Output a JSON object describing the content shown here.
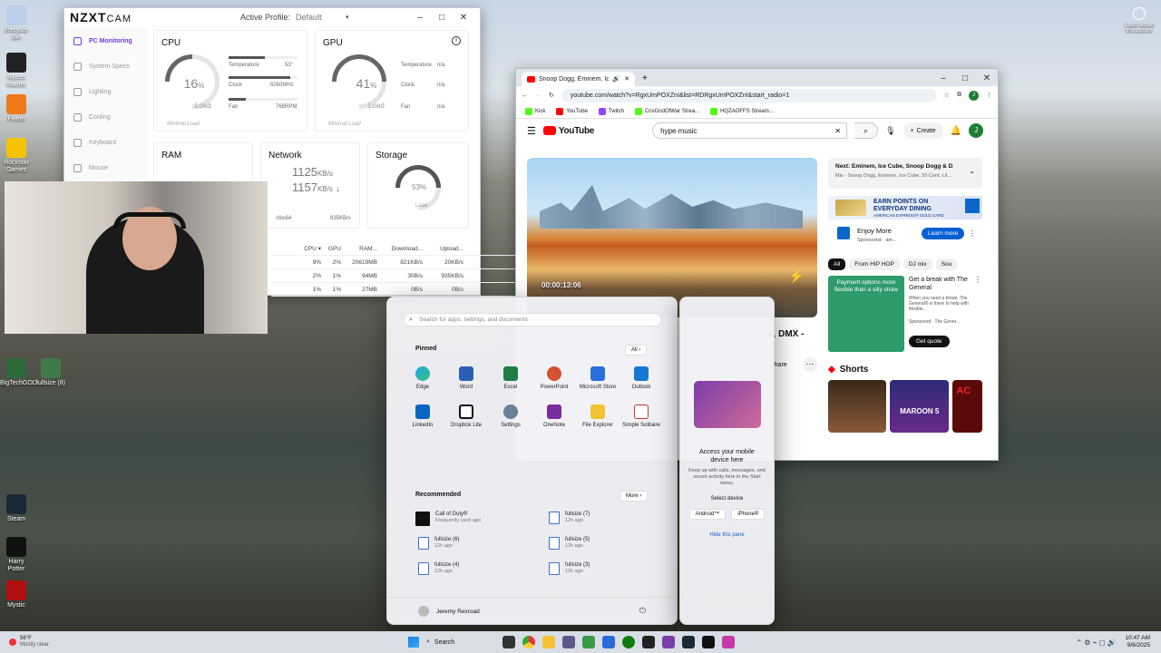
{
  "desktop": {
    "learn_about": "Learn about this picture",
    "icons": [
      "Recycle Bin",
      "Ryzen Master",
      "Fivem",
      "Rockstar Games",
      "BigTechGOD...",
      "fullsize (8)",
      "Steam",
      "Harry Potter",
      "Mystic"
    ]
  },
  "nzxt": {
    "logo": "NZXT",
    "logo_sub": "CAM",
    "profile_label": "Active Profile:",
    "profile_value": "Default",
    "nav": [
      "PC Monitoring",
      "System Specs",
      "Lighting",
      "Cooling",
      "Keyboard",
      "Mouse"
    ],
    "cpu": {
      "title": "CPU",
      "load": "16",
      "load_unit": "%",
      "load_label": "Load",
      "temp_label": "Temperature",
      "temp_value": "53°",
      "clock_label": "Clock",
      "clock_value": "5050MHz",
      "fan_label": "Fan",
      "fan_value": "768RPM",
      "footer": "Minimal Load"
    },
    "gpu": {
      "title": "GPU",
      "load": "41",
      "load_unit": "%",
      "load_label": "Load",
      "temp_label": "Temperature",
      "temp_value": "n/a",
      "clock_label": "Clock",
      "clock_value": "n/a",
      "fan_label": "Fan",
      "fan_value": "n/a",
      "footer": "Minimal Load"
    },
    "ram": {
      "title": "RAM"
    },
    "network": {
      "title": "Network",
      "down": "1125",
      "up": "1157",
      "unit": "KB/s",
      "adapter": "clbs64",
      "adapter_val": "935KB/s"
    },
    "storage": {
      "title": "Storage",
      "load": "53%",
      "load_label": "Load"
    },
    "table": {
      "headers": [
        "CPU ▾",
        "GPU",
        "RAM...",
        "Download...",
        "Upload..."
      ],
      "rows": [
        [
          "9%",
          "2%",
          "20619MB",
          "821KB/s",
          "20KB/s"
        ],
        [
          "2%",
          "1%",
          "94MB",
          "30B/s",
          "935KB/s"
        ],
        [
          "1%",
          "1%",
          "27MB",
          "0B/s",
          "0B/s"
        ]
      ]
    }
  },
  "chrome": {
    "tab_title": "Snoop Dogg, Eminem, Ice C",
    "url": "youtube.com/watch?v=RgxUmPOXZnI&list=RDRgxUmPOXZnI&start_radio=1",
    "bookmarks": [
      "Kick",
      "YouTube",
      "Twitch",
      "CrisGodOfWar Strea...",
      "HQZAOFFS Stream..."
    ],
    "yt": {
      "logo": "YouTube",
      "search": "hype music",
      "create": "Create",
      "avatar": "J",
      "time": "00:00:13:06",
      "title_frag": "e, DMX -",
      "share": "Share",
      "next_title": "Next: Eminem, Ice Cube, Snoop Dogg & D...",
      "next_sub": "Mix - Snoop Dogg, Eminem, Ice Cube, 50 Cent, Lil...",
      "ad1_title": "EARN POINTS ON EVERYDAY DINING",
      "ad1_sub": "AMERICAN EXPRESS® GOLD CARD",
      "ad1_cta": "Enjoy More",
      "ad1_spon": "Sponsored · am...",
      "ad1_btn": "Learn more",
      "chips": [
        "All",
        "From HIP HOP",
        "DJ mix",
        "Sou"
      ],
      "ad2_img": "Payment options more flexible than a silly straw",
      "ad2_title": "Get a break with The General",
      "ad2_desc": "When you need a break, The General® is there to help with flexible...",
      "ad2_spon": "Sponsored · The Gener...",
      "ad2_btn": "Get quote",
      "shorts": "Shorts",
      "short2": "MAROON 5",
      "short3": "AC"
    }
  },
  "start": {
    "search_placeholder": "Search for apps, settings, and documents",
    "pinned": "Pinned",
    "all": "All",
    "apps": [
      "Edge",
      "Word",
      "Excel",
      "PowerPoint",
      "Microsoft Store",
      "Outlook",
      "LinkedIn",
      "Dropbox Lite",
      "Settings",
      "OneNote",
      "File Explorer",
      "Simple Solitaire"
    ],
    "recommended": "Recommended",
    "more": "More",
    "rec": [
      {
        "name": "Call of Duty®",
        "sub": "Frequently used app"
      },
      {
        "name": "fullsize (7)",
        "sub": "12h ago"
      },
      {
        "name": "fullsize (6)",
        "sub": "12h ago"
      },
      {
        "name": "fullsize (5)",
        "sub": "12h ago"
      },
      {
        "name": "fullsize (4)",
        "sub": "12h ago"
      },
      {
        "name": "fullsize (3)",
        "sub": "12h ago"
      }
    ],
    "user": "Jeremy Rexroad"
  },
  "phone": {
    "title": "Access your mobile device here",
    "desc": "Keep up with calls, messages, and recent activity here in the Start menu.",
    "select": "Select device",
    "android": "Android™",
    "iphone": "iPhone®",
    "hide": "Hide this pane"
  },
  "taskbar": {
    "weather_temp": "56°F",
    "weather_desc": "Mostly clear",
    "search": "Search",
    "time": "10:47 AM",
    "date": "9/6/2025"
  }
}
